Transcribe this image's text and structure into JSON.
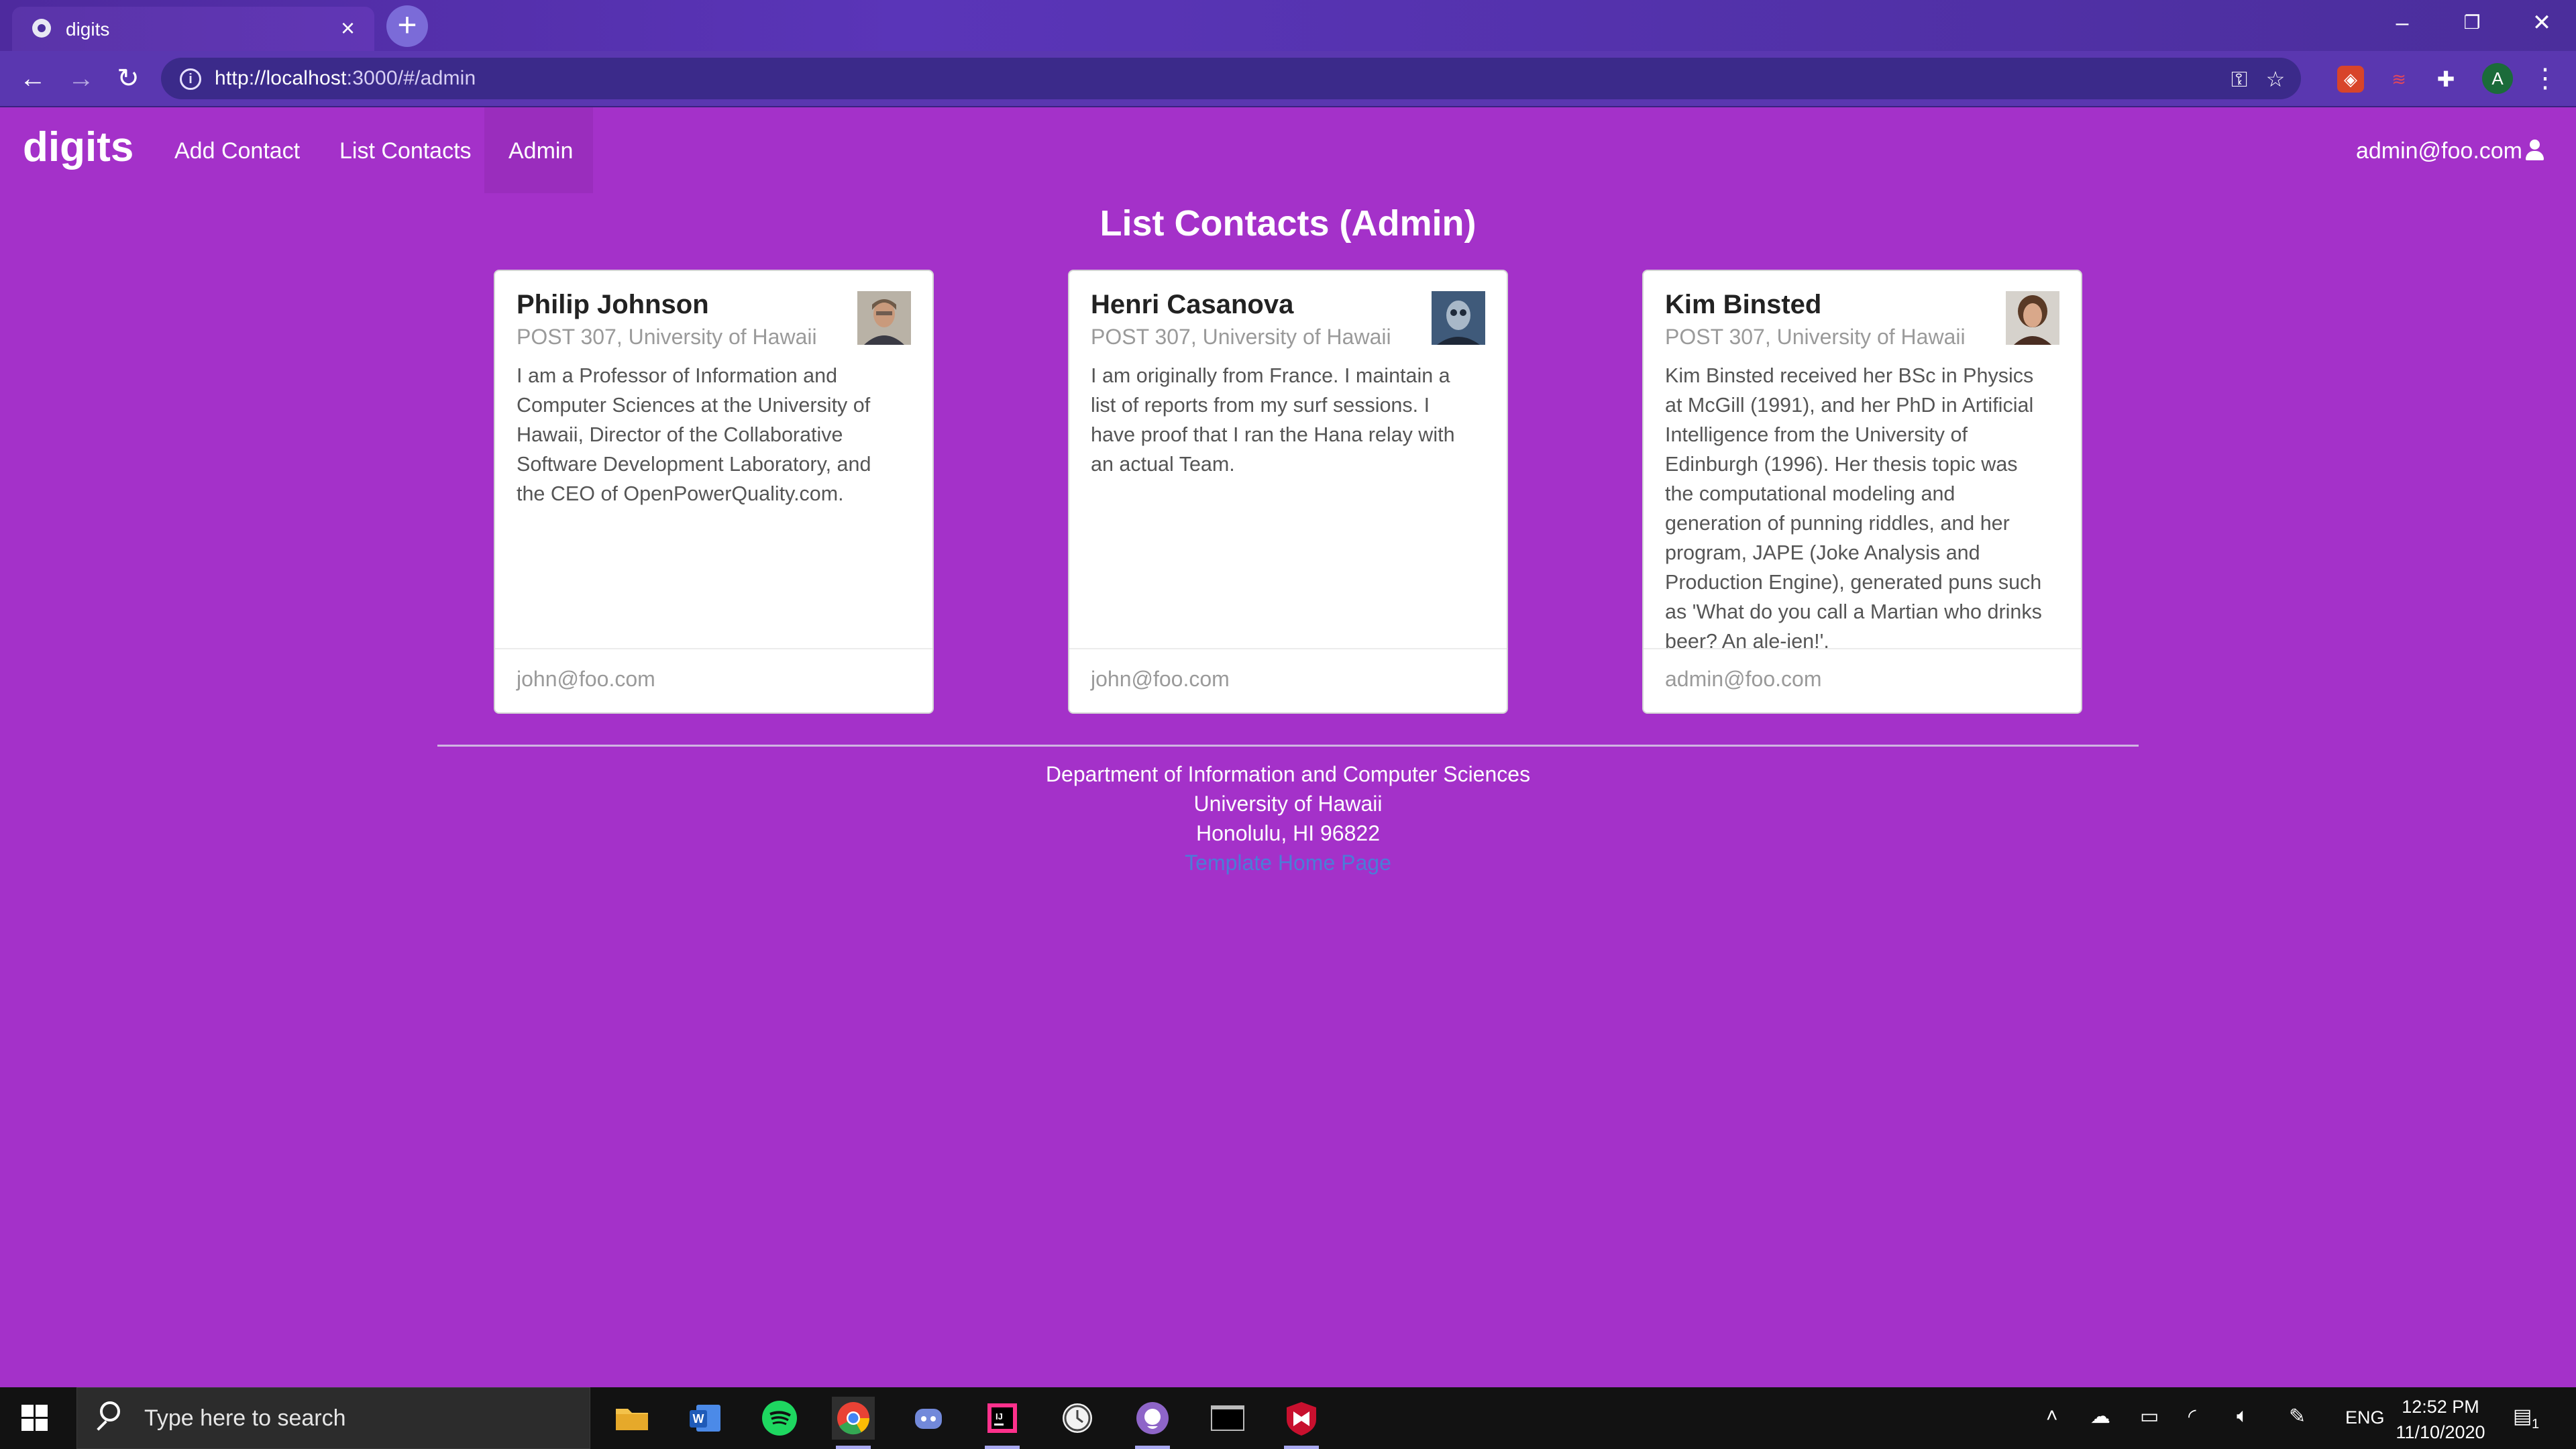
{
  "browser": {
    "tab_title": "digits",
    "url_host": "http://localhost",
    "url_path": ":3000/#/admin",
    "profile_initial": "A"
  },
  "navbar": {
    "brand": "digits",
    "links": [
      "Add Contact",
      "List Contacts",
      "Admin"
    ],
    "user": "admin@foo.com"
  },
  "page": {
    "title": "List Contacts (Admin)"
  },
  "contacts": [
    {
      "name": "Philip Johnson",
      "address": "POST 307, University of Hawaii",
      "description": "I am a Professor of Information and Computer Sciences at the University of Hawaii, Director of the Collaborative Software Development Laboratory, and the CEO of OpenPowerQuality.com.",
      "email": "john@foo.com"
    },
    {
      "name": "Henri Casanova",
      "address": "POST 307, University of Hawaii",
      "description": "I am originally from France. I maintain a list of reports from my surf sessions. I have proof that I ran the Hana relay with an actual Team.",
      "email": "john@foo.com"
    },
    {
      "name": "Kim Binsted",
      "address": "POST 307, University of Hawaii",
      "description": "Kim Binsted received her BSc in Physics at McGill (1991), and her PhD in Artificial Intelligence from the University of Edinburgh (1996). Her thesis topic was the computational modeling and generation of punning riddles, and her program, JAPE (Joke Analysis and Production Engine), generated puns such as 'What do you call a Martian who drinks beer? An ale-ien!'.",
      "email": "admin@foo.com"
    }
  ],
  "footer": {
    "line1": "Department of Information and Computer Sciences",
    "line2": "University of Hawaii",
    "line3": "Honolulu, HI 96822",
    "link": "Template Home Page"
  },
  "taskbar": {
    "search_placeholder": "Type here to search",
    "lang": "ENG",
    "time": "12:52 PM",
    "date": "11/10/2020",
    "notification_count": "1"
  },
  "colors": {
    "page_bg": "#a431c9",
    "card_bg": "#ffffff",
    "footer_link": "#4a7dd8"
  }
}
